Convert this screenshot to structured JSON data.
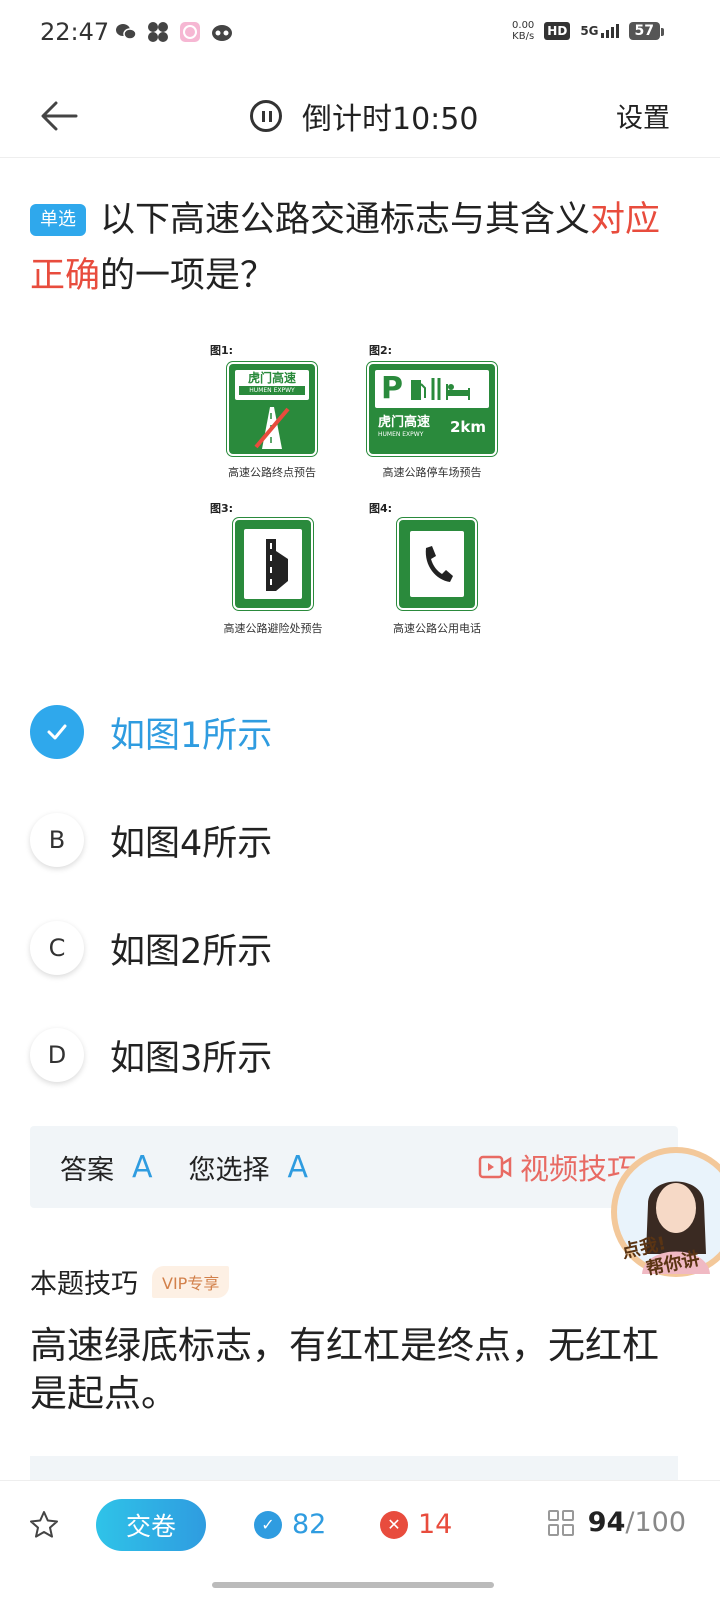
{
  "status_bar": {
    "time": "22:47",
    "net_speed_value": "0.00",
    "net_speed_unit": "KB/s",
    "hd": "HD",
    "network": "5G",
    "battery": "57"
  },
  "header": {
    "timer": "倒计时10:50",
    "settings": "设置"
  },
  "question": {
    "badge": "单选",
    "text_part1": "以下高速公路交通标志与其含义",
    "text_highlight": "对应正确",
    "text_part2": "的一项是？"
  },
  "figure": {
    "items": [
      {
        "caption": "图1:",
        "label": "高速公路终点预告",
        "sign_text": "虎门高速",
        "sign_sub": "HUMEN EXPWY"
      },
      {
        "caption": "图2:",
        "label": "高速公路停车场预告",
        "sign_text": "虎门高速",
        "sign_sub": "HUMEN EXPWY",
        "sign_distance": "2km",
        "sign_letter": "P"
      },
      {
        "caption": "图3:",
        "label": "高速公路避险处预告"
      },
      {
        "caption": "图4:",
        "label": "高速公路公用电话"
      }
    ]
  },
  "options": [
    {
      "letter": "A",
      "text": "如图1所示",
      "selected": true
    },
    {
      "letter": "B",
      "text": "如图4所示"
    },
    {
      "letter": "C",
      "text": "如图2所示"
    },
    {
      "letter": "D",
      "text": "如图3所示"
    }
  ],
  "answer": {
    "answer_label": "答案",
    "answer_value": "A",
    "your_choice_label": "您选择",
    "your_choice_value": "A",
    "video_tip": "视频技巧",
    "avatar_text_1": "点我!",
    "avatar_text_2": "帮你讲"
  },
  "tips": {
    "title": "本题技巧",
    "vip": "VIP专享",
    "body": "高速绿底标志，有红杠是终点，无红杠是起点。"
  },
  "bottom_bar": {
    "submit": "交卷",
    "correct_count": "82",
    "wrong_count": "14",
    "current": "94",
    "total": "/100"
  },
  "colors": {
    "accent": "#2fa8ec",
    "correct": "#2f9ce0",
    "wrong": "#e84c3d",
    "sign_green": "#2a8a3c"
  }
}
